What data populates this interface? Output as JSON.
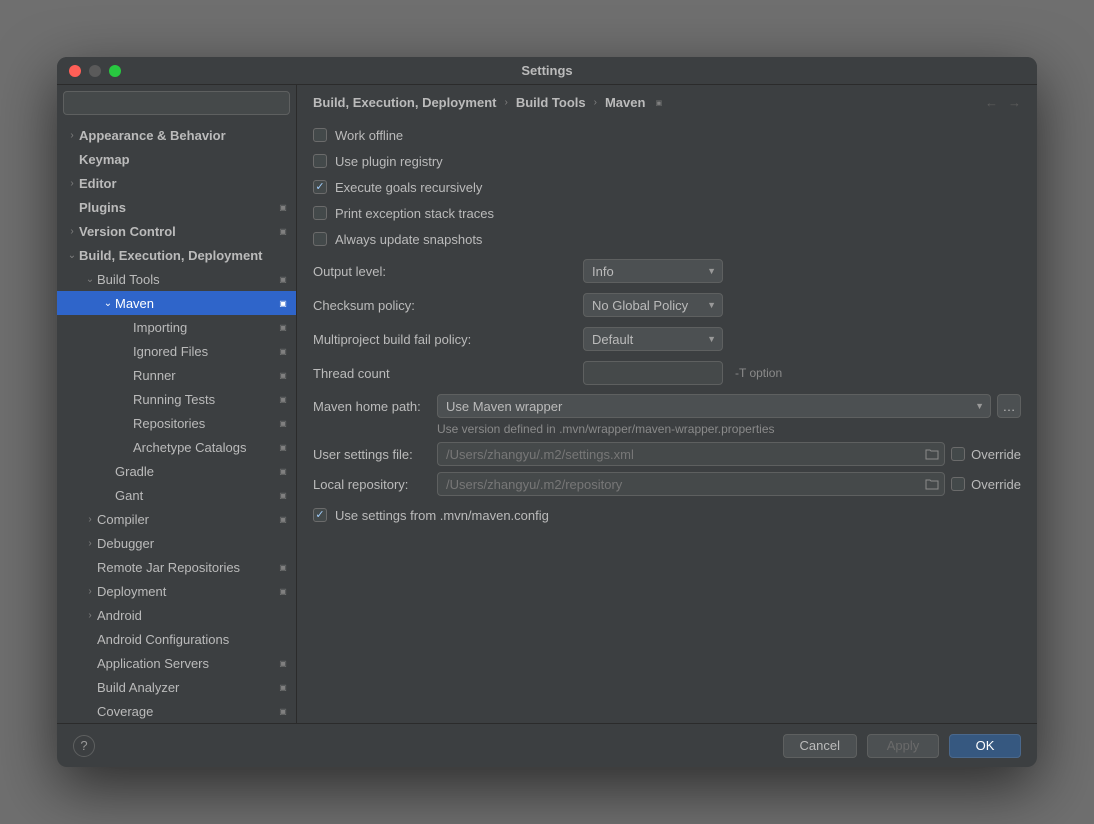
{
  "window": {
    "title": "Settings"
  },
  "sidebar": {
    "search_placeholder": "",
    "items": [
      {
        "label": "Appearance & Behavior",
        "depth": 0,
        "chev": ">",
        "bold": true
      },
      {
        "label": "Keymap",
        "depth": 0,
        "chev": "",
        "bold": true
      },
      {
        "label": "Editor",
        "depth": 0,
        "chev": ">",
        "bold": true
      },
      {
        "label": "Plugins",
        "depth": 0,
        "chev": "",
        "bold": true,
        "badge": true
      },
      {
        "label": "Version Control",
        "depth": 0,
        "chev": ">",
        "bold": true,
        "badge": true
      },
      {
        "label": "Build, Execution, Deployment",
        "depth": 0,
        "chev": "v",
        "bold": true
      },
      {
        "label": "Build Tools",
        "depth": 1,
        "chev": "v",
        "badge": true
      },
      {
        "label": "Maven",
        "depth": 2,
        "chev": "v",
        "badge": true,
        "selected": true
      },
      {
        "label": "Importing",
        "depth": 3,
        "chev": "",
        "badge": true
      },
      {
        "label": "Ignored Files",
        "depth": 3,
        "chev": "",
        "badge": true
      },
      {
        "label": "Runner",
        "depth": 3,
        "chev": "",
        "badge": true
      },
      {
        "label": "Running Tests",
        "depth": 3,
        "chev": "",
        "badge": true
      },
      {
        "label": "Repositories",
        "depth": 3,
        "chev": "",
        "badge": true
      },
      {
        "label": "Archetype Catalogs",
        "depth": 3,
        "chev": "",
        "badge": true
      },
      {
        "label": "Gradle",
        "depth": 2,
        "chev": "",
        "badge": true
      },
      {
        "label": "Gant",
        "depth": 2,
        "chev": "",
        "badge": true
      },
      {
        "label": "Compiler",
        "depth": 1,
        "chev": ">",
        "badge": true
      },
      {
        "label": "Debugger",
        "depth": 1,
        "chev": ">"
      },
      {
        "label": "Remote Jar Repositories",
        "depth": 1,
        "chev": "",
        "badge": true
      },
      {
        "label": "Deployment",
        "depth": 1,
        "chev": ">",
        "badge": true
      },
      {
        "label": "Android",
        "depth": 1,
        "chev": ">"
      },
      {
        "label": "Android Configurations",
        "depth": 1,
        "chev": ""
      },
      {
        "label": "Application Servers",
        "depth": 1,
        "chev": "",
        "badge": true
      },
      {
        "label": "Build Analyzer",
        "depth": 1,
        "chev": "",
        "badge": true
      },
      {
        "label": "Coverage",
        "depth": 1,
        "chev": "",
        "badge": true
      }
    ]
  },
  "breadcrumbs": [
    "Build, Execution, Deployment",
    "Build Tools",
    "Maven"
  ],
  "form": {
    "checkboxes": {
      "work_offline": {
        "label": "Work offline",
        "checked": false
      },
      "use_plugin_registry": {
        "label": "Use plugin registry",
        "checked": false
      },
      "execute_goals_recursively": {
        "label": "Execute goals recursively",
        "checked": true
      },
      "print_exception_stack_traces": {
        "label": "Print exception stack traces",
        "checked": false
      },
      "always_update_snapshots": {
        "label": "Always update snapshots",
        "checked": false
      },
      "use_settings_from_mvn": {
        "label": "Use settings from .mvn/maven.config",
        "checked": true
      }
    },
    "output_level": {
      "label": "Output level:",
      "value": "Info"
    },
    "checksum_policy": {
      "label": "Checksum policy:",
      "value": "No Global Policy"
    },
    "multiproject_policy": {
      "label": "Multiproject build fail policy:",
      "value": "Default"
    },
    "thread_count": {
      "label": "Thread count",
      "value": "",
      "hint": "-T option"
    },
    "maven_home_path": {
      "label": "Maven home path:",
      "value": "Use Maven wrapper",
      "hint": "Use version defined in .mvn/wrapper/maven-wrapper.properties"
    },
    "user_settings_file": {
      "label": "User settings file:",
      "value": "/Users/zhangyu/.m2/settings.xml",
      "override_label": "Override",
      "override_checked": false
    },
    "local_repository": {
      "label": "Local repository:",
      "value": "/Users/zhangyu/.m2/repository",
      "override_label": "Override",
      "override_checked": false
    }
  },
  "footer": {
    "cancel": "Cancel",
    "apply": "Apply",
    "ok": "OK"
  }
}
